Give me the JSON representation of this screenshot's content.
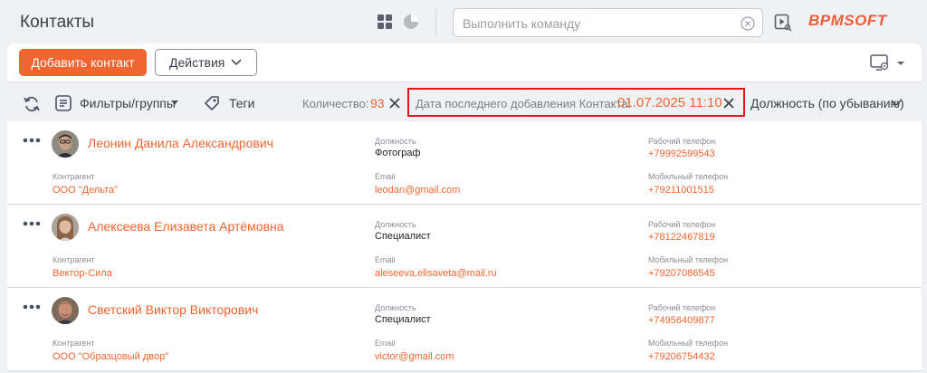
{
  "header": {
    "title": "Контакты",
    "command_placeholder": "Выполнить команду",
    "logo": "BPMSOFT",
    "icons": [
      "grid-view-icon",
      "dashboard-view-icon",
      "clear-icon",
      "video-play-icon"
    ]
  },
  "toolbar": {
    "add_label": "Добавить контакт",
    "actions_label": "Действия",
    "icons": [
      "chevron-down-icon",
      "view-settings-icon"
    ]
  },
  "filters": {
    "refresh_icon": "refresh-icon",
    "filters_label": "Фильтры/группы",
    "tags_label": "Теги",
    "count_label": "Количество:",
    "count_value": "93",
    "date_label": "Дата последнего добавления Контакта:",
    "date_value": "01.07.2025 11:10",
    "sort_label": "Должность (по убыванию)"
  },
  "field_labels": {
    "position": "Должность",
    "work_phone": "Рабочий телефон",
    "account": "Контрагент",
    "email": "Email",
    "mobile_phone": "Мобильный телефон"
  },
  "contacts": [
    {
      "name": "Леонин Данила Александрович",
      "position": "Фотограф",
      "work_phone": "+79992599543",
      "account": "ООО \"Дельта\"",
      "email": "leodan@gmail.com",
      "mobile_phone": "+79211001515"
    },
    {
      "name": "Алексеева Елизавета Артёмовна",
      "position": "Специалист",
      "work_phone": "+78122467819",
      "account": "Вектор-Сила",
      "email": "aleseeva.elisaveta@mail.ru",
      "mobile_phone": "+79207086545"
    },
    {
      "name": "Светский Виктор Викторович",
      "position": "Специалист",
      "work_phone": "+74956409877",
      "account": "ООО \"Образцовый двор\"",
      "email": "victor@gmail.com",
      "mobile_phone": "+79206754432"
    }
  ],
  "colors": {
    "accent": "#f26530",
    "highlight_border": "#e3171b",
    "background": "#f0f1f4"
  }
}
